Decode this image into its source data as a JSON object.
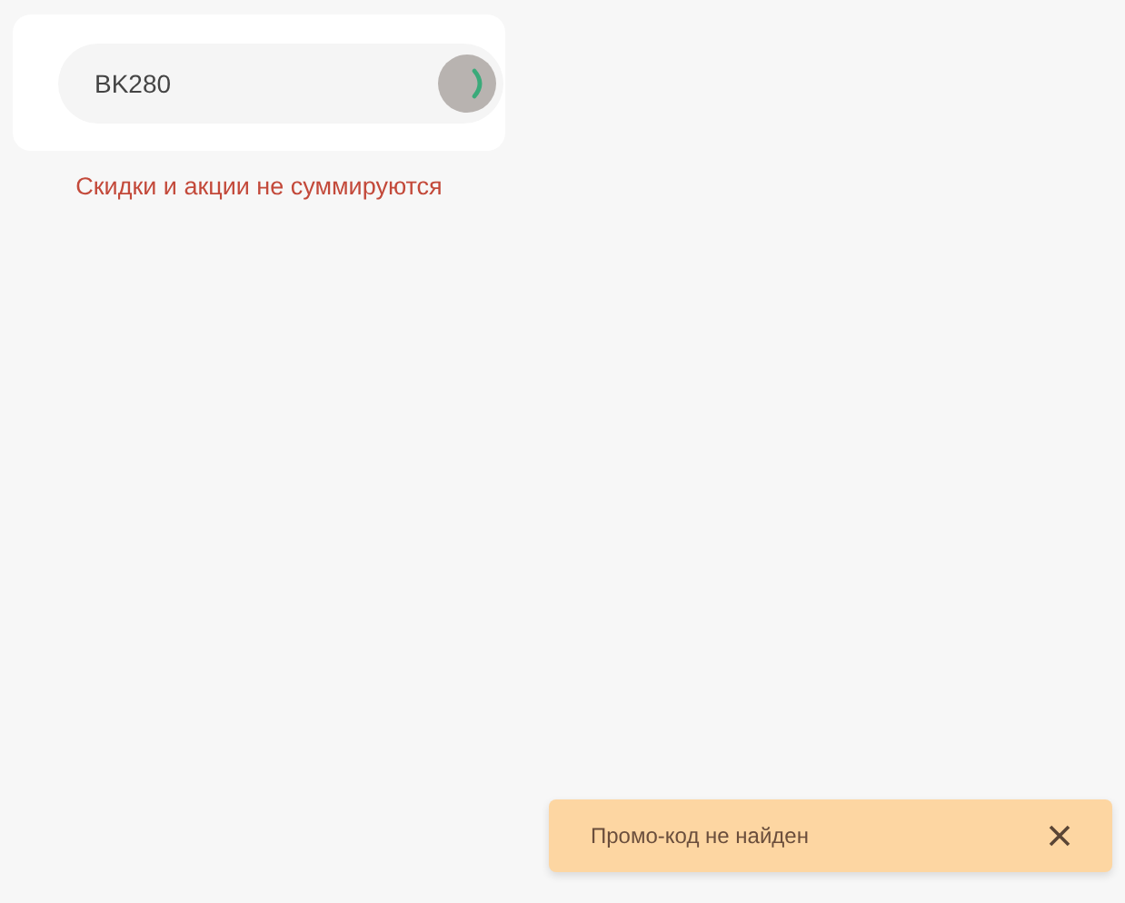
{
  "promo_form": {
    "code_value": "BK280",
    "loading": true,
    "note": "Скидки и акции не суммируются"
  },
  "toast": {
    "message": "Промо-код не найден"
  }
}
